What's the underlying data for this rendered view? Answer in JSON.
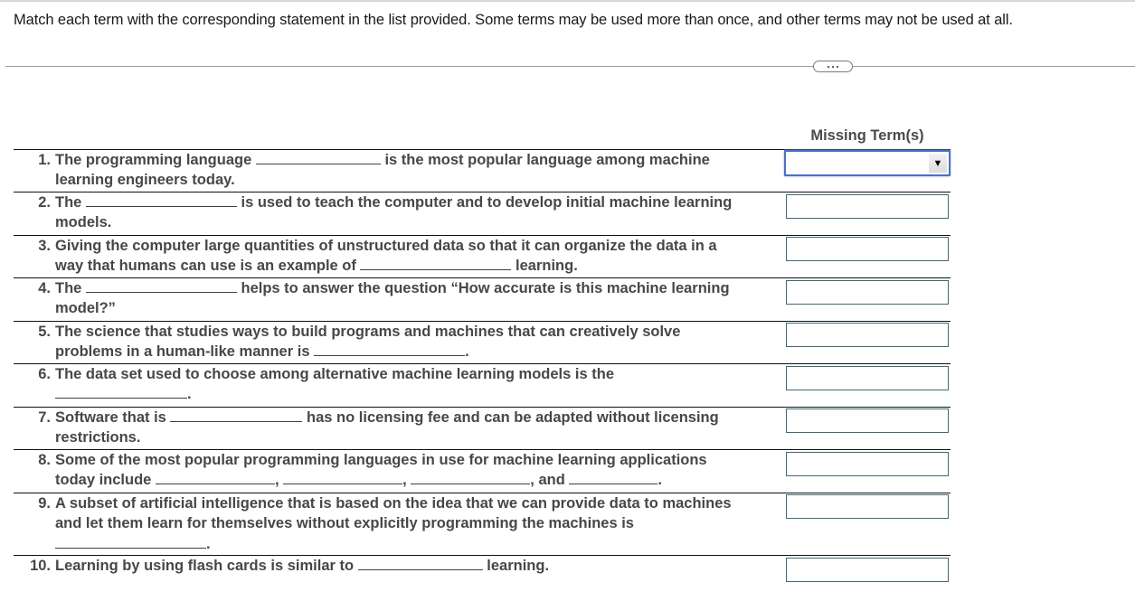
{
  "instructions": "Match each term with the corresponding statement in the list provided. Some terms may be used more than once, and other terms may not be used at all.",
  "more_button": {
    "icon": "ellipsis-icon"
  },
  "column_header": "Missing Term(s)",
  "dropdown": {
    "selected": "",
    "icon": "dropdown-arrow-icon",
    "arrow_glyph": "▼"
  },
  "questions": [
    {
      "num": "1.",
      "lines": [
        [
          "The programming language ",
          "__",
          " is the most popular language among machine"
        ],
        [
          "learning engineers today."
        ]
      ],
      "answer": ""
    },
    {
      "num": "2.",
      "lines": [
        [
          "The ",
          "__",
          " is used to teach the computer and to develop initial machine learning"
        ],
        [
          "models."
        ]
      ],
      "answer": ""
    },
    {
      "num": "3.",
      "lines": [
        [
          "Giving the computer large quantities of unstructured data so that it can organize the data in a"
        ],
        [
          "way that humans can use is an example of ",
          "__",
          " learning."
        ]
      ],
      "answer": ""
    },
    {
      "num": "4.",
      "lines": [
        [
          "The ",
          "__",
          " helps to answer the question “How accurate is this machine learning"
        ],
        [
          "model?”"
        ]
      ],
      "answer": ""
    },
    {
      "num": "5.",
      "lines": [
        [
          "The science that studies ways to build programs and machines that can creatively solve"
        ],
        [
          "problems in a human-like manner is ",
          "__",
          "."
        ]
      ],
      "answer": ""
    },
    {
      "num": "6.",
      "lines": [
        [
          "The data set used to choose among alternative machine learning models is the"
        ],
        [
          "__",
          "."
        ]
      ],
      "answer": ""
    },
    {
      "num": "7.",
      "lines": [
        [
          "Software that is ",
          "__",
          " has no licensing fee and can be adapted without licensing"
        ],
        [
          "restrictions."
        ]
      ],
      "answer": ""
    },
    {
      "num": "8.",
      "lines": [
        [
          "Some of the most popular programming languages in use for machine learning applications"
        ],
        [
          "today include ",
          "__",
          ", ",
          "__",
          ", ",
          "__",
          ", and ",
          "__",
          "."
        ]
      ],
      "answer": ""
    },
    {
      "num": "9.",
      "lines": [
        [
          "A subset of artificial intelligence that is based on the idea that we can provide data to machines"
        ],
        [
          "and let them learn for themselves without explicitly programming the machines is"
        ],
        [
          "__",
          "."
        ]
      ],
      "answer": ""
    },
    {
      "num": "10.",
      "lines": [
        [
          "Learning by using flash cards is similar to ",
          "__",
          " learning."
        ]
      ],
      "answer": ""
    }
  ]
}
